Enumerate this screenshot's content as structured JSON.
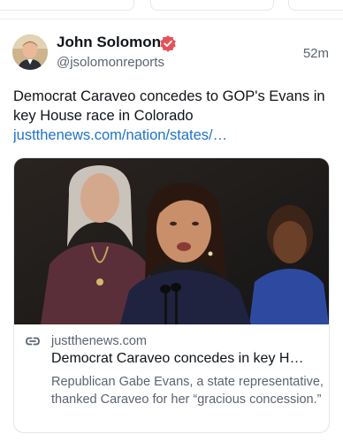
{
  "post": {
    "author_name": "John Solomon",
    "author_handle": "@jsolomonreports",
    "timestamp": "52m",
    "verified_badge_color": "#e2545a",
    "text": "Democrat Caraveo concedes to GOP's Evans in key House race in Colorado",
    "link_text": "justthenews.com/nation/states/…",
    "link_color": "#1d73c9"
  },
  "card": {
    "domain": "justthenews.com",
    "title": "Democrat Caraveo concedes in key H…",
    "description": "Republican Gabe Evans, a state representative, thanked Caraveo for her “gracious concession.”"
  },
  "icons": {
    "verified": "verified-badge-icon",
    "link": "link-icon"
  }
}
